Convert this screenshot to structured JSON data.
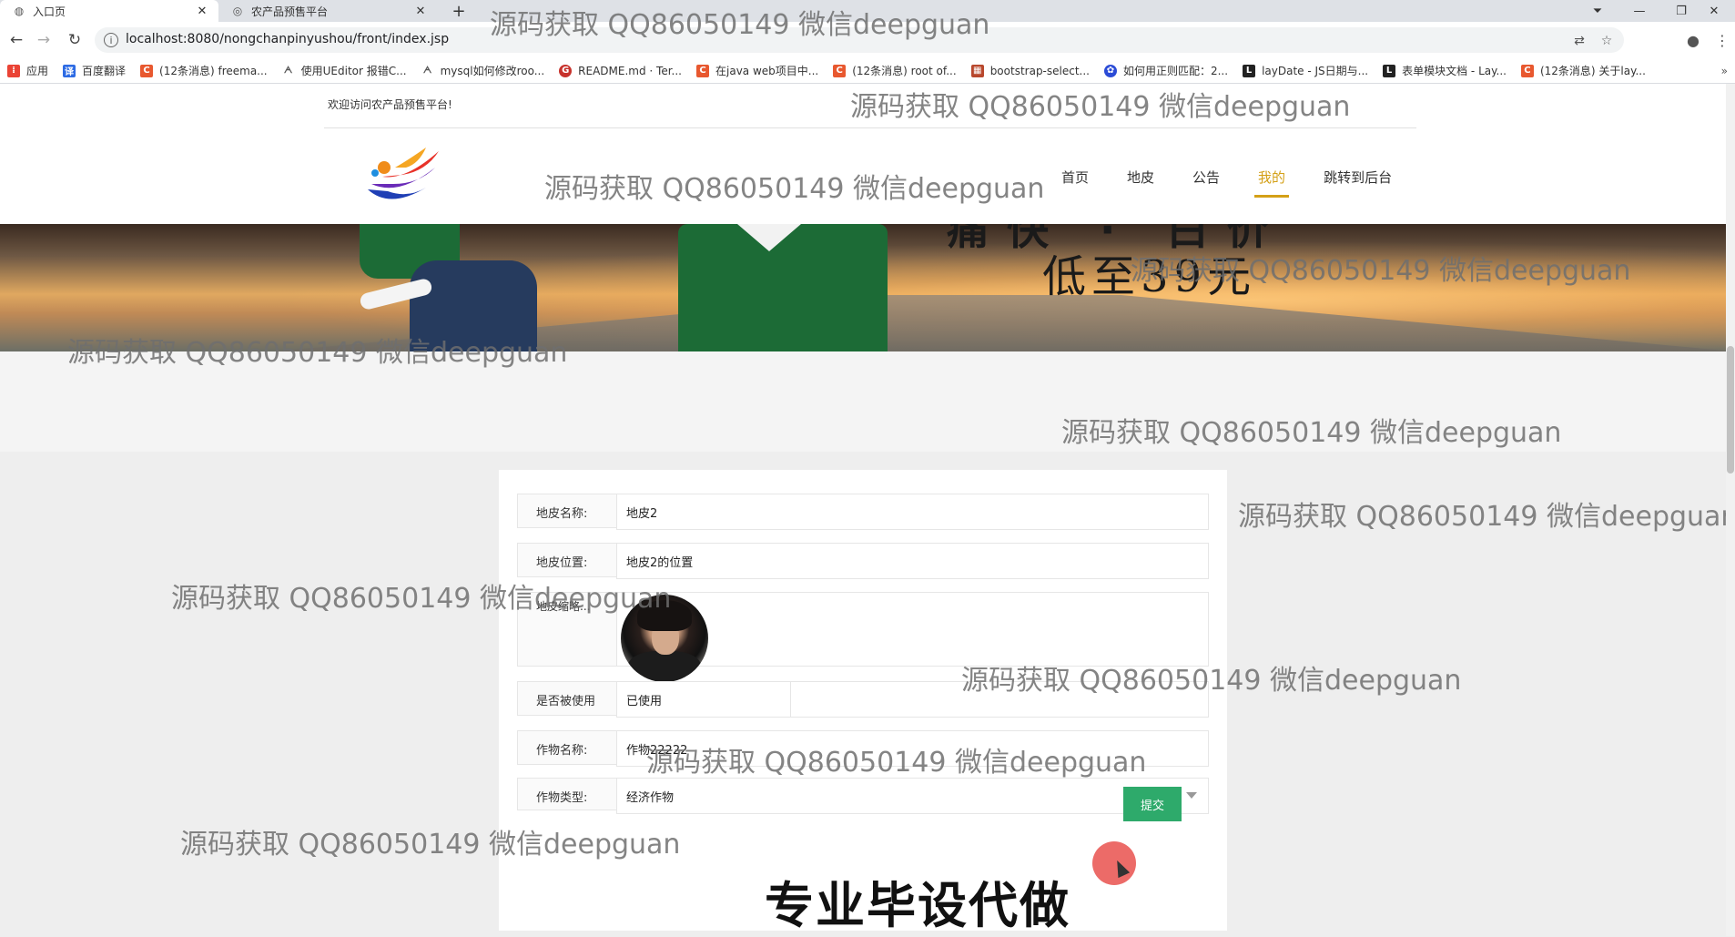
{
  "browser": {
    "tabs": [
      {
        "title": "入口页",
        "icon": "globe-icon",
        "active": true
      },
      {
        "title": "农产品预售平台",
        "icon": "settings-icon",
        "active": false
      }
    ],
    "new_tab_label": "+",
    "url": "localhost:8080/nongchanpinyushou/front/index.jsp",
    "bookmarks": [
      {
        "label": "应用",
        "color": "#ea4335"
      },
      {
        "label": "百度翻译",
        "color": "#2d6be4"
      },
      {
        "label": "(12条消息) freema...",
        "color": "#e8582f"
      },
      {
        "label": "使用UEditor 报错C...",
        "color": "#555555"
      },
      {
        "label": "mysql如何修改roo...",
        "color": "#555555"
      },
      {
        "label": "README.md · Ter...",
        "color": "#c7322c"
      },
      {
        "label": "在java web项目中...",
        "color": "#e8582f"
      },
      {
        "label": "(12条消息) root of...",
        "color": "#e8582f"
      },
      {
        "label": "bootstrap-select...",
        "color": "#b8472c"
      },
      {
        "label": "如何用正则匹配：2...",
        "color": "#2b4bd6"
      },
      {
        "label": "layDate - JS日期与...",
        "color": "#222222"
      },
      {
        "label": "表单模块文档 - Lay...",
        "color": "#222222"
      },
      {
        "label": "(12条消息) 关于lay...",
        "color": "#e8582f"
      }
    ],
    "bookmarks_more": "»"
  },
  "site": {
    "welcome": "欢迎访问农产品预售平台!",
    "nav": [
      {
        "label": "首页",
        "active": false
      },
      {
        "label": "地皮",
        "active": false
      },
      {
        "label": "公告",
        "active": false
      },
      {
        "label": "我的",
        "active": true
      },
      {
        "label": "跳转到后台",
        "active": false
      }
    ],
    "accent_color": "#d4a017",
    "banner_text": "低至39元",
    "banner_top_text": "痛快 · 白价"
  },
  "form": {
    "fields": {
      "name": {
        "label": "地皮名称:",
        "value": "地皮2"
      },
      "location": {
        "label": "地皮位置:",
        "value": "地皮2的位置"
      },
      "thumbnail": {
        "label": "地皮缩略..."
      },
      "used": {
        "label": "是否被使用",
        "value": "已使用"
      },
      "crop_name": {
        "label": "作物名称:",
        "value": "作物22222"
      },
      "crop_type": {
        "label": "作物类型:",
        "value": "经济作物"
      }
    },
    "submit_label": "提交",
    "submit_color": "#2eaa6b"
  },
  "overlays": {
    "watermark": "源码获取 QQ86050149 微信deepguan",
    "promo": "专业毕设代做"
  }
}
